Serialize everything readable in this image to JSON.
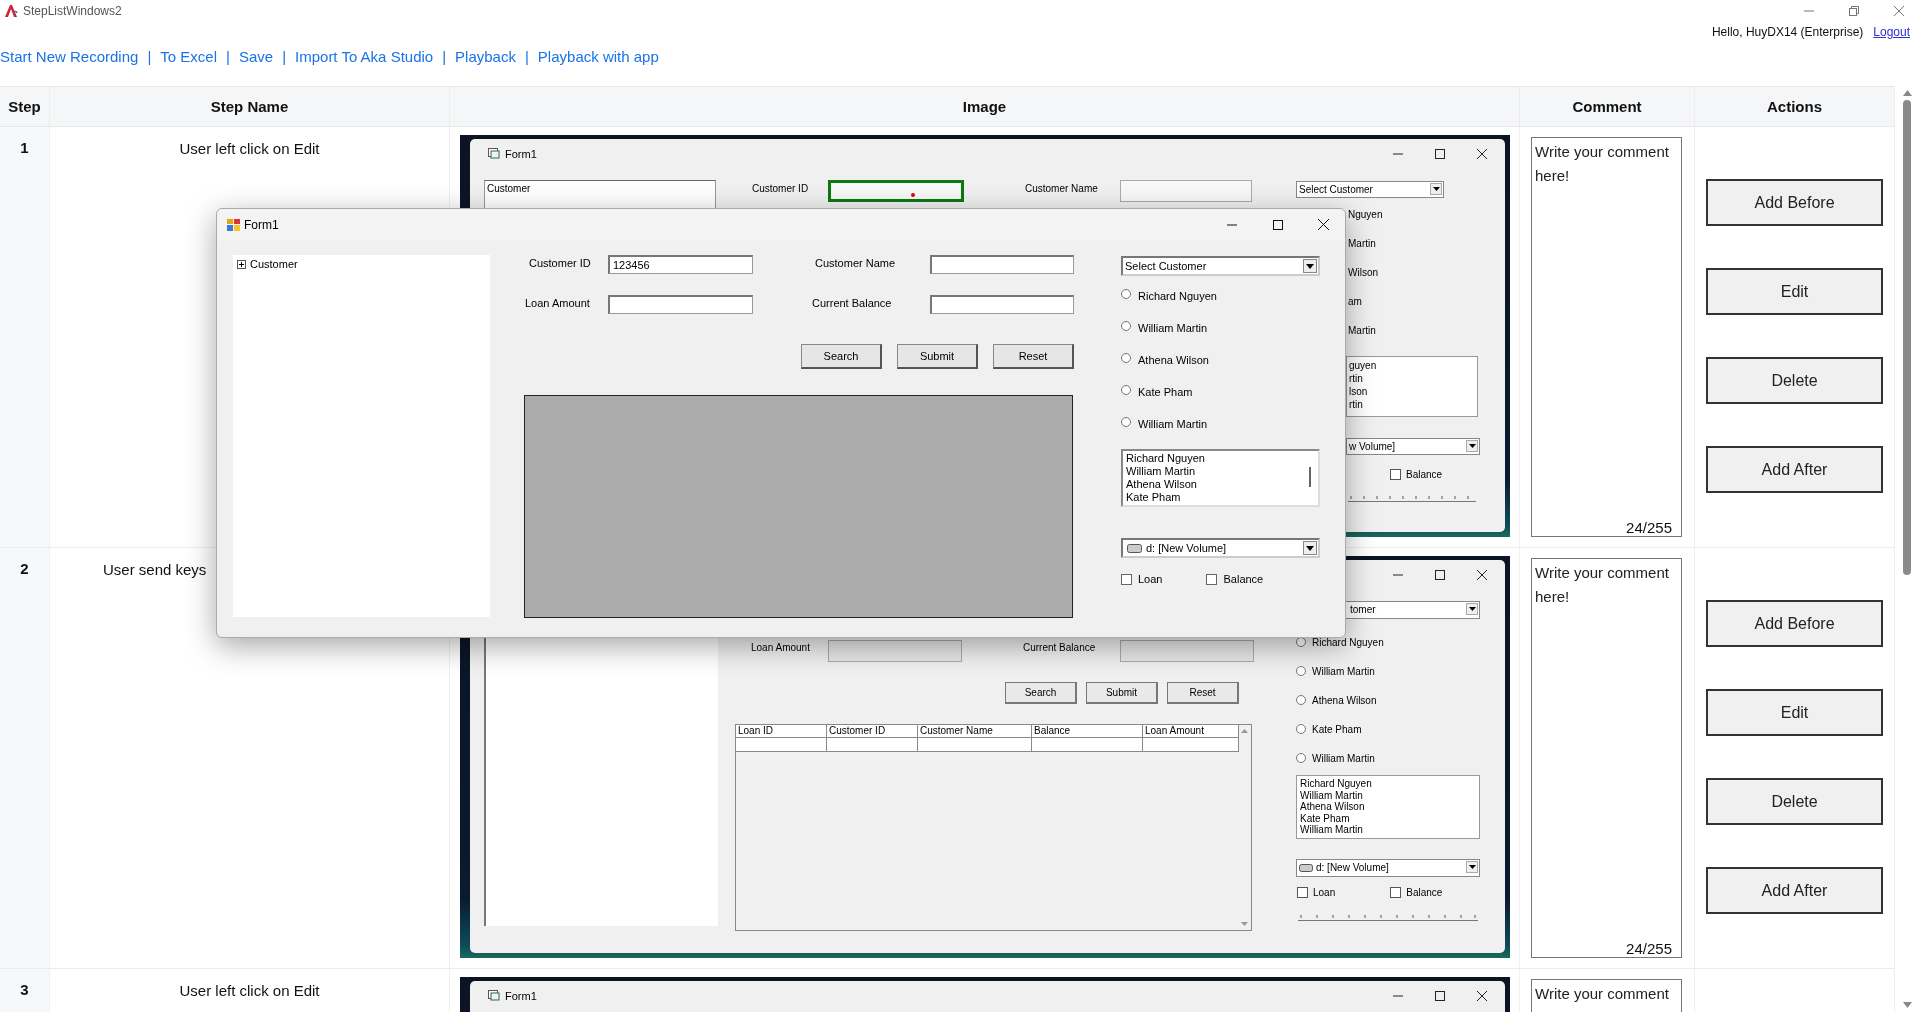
{
  "window": {
    "title": "StepListWindows2"
  },
  "account": {
    "greeting": "Hello, HuyDX14 (Enterprise)",
    "logout": "Logout"
  },
  "links": [
    {
      "label": "Start New Recording"
    },
    {
      "label": "To Excel"
    },
    {
      "label": "Save"
    },
    {
      "label": "Import To Aka Studio"
    },
    {
      "label": "Playback"
    },
    {
      "label": "Playback with app"
    }
  ],
  "separators": [
    "|",
    "|",
    "|",
    "|",
    "|"
  ],
  "table": {
    "columns": [
      "Step",
      "Step Name",
      "Image",
      "Comment",
      "Actions"
    ],
    "rows": [
      {
        "step": "1",
        "name": "User left click on Edit",
        "clipped": false,
        "comment": {
          "placeholder": "Write your comment here!",
          "count": "24/255"
        },
        "actions": [
          "Add Before",
          "Edit",
          "Delete",
          "Add After"
        ],
        "screenshot": {
          "kind": "top",
          "title": "Form1",
          "tree_field": "Customer",
          "fields": [
            {
              "label": "Customer ID",
              "highlighted": true
            },
            {
              "label": "Customer Name",
              "highlighted": false
            }
          ],
          "dropdown": "Select Customer",
          "radio_tails": [
            "Nguyen",
            "Martin",
            "Wilson",
            "am",
            "Martin"
          ],
          "list_tails": [
            "guyen",
            "rtin",
            "lson",
            "rtin"
          ],
          "drive_tail": "w Volume]",
          "checkboxes": [
            {
              "label": "Balance",
              "checked": false
            }
          ]
        }
      },
      {
        "step": "2",
        "name": "User send keys",
        "clipped": true,
        "comment": {
          "placeholder": "Write your comment here!",
          "count": "24/255"
        },
        "actions": [
          "Add Before",
          "Edit",
          "Delete",
          "Add After"
        ],
        "screenshot": {
          "kind": "bottom",
          "dropdown_tail": "tomer",
          "fields": [
            {
              "label": "Loan Amount"
            },
            {
              "label": "Current Balance"
            }
          ],
          "buttons": [
            "Search",
            "Submit",
            "Reset"
          ],
          "grid_columns": [
            "Loan ID",
            "Customer ID",
            "Customer Name",
            "Balance",
            "Loan Amount"
          ],
          "radios": [
            {
              "label": "Richard Nguyen",
              "selected": false
            },
            {
              "label": "William Martin",
              "selected": false
            },
            {
              "label": "Athena Wilson",
              "selected": false
            },
            {
              "label": "Kate Pham",
              "selected": false
            },
            {
              "label": "William Martin",
              "selected": false
            }
          ],
          "listbox": [
            "Richard Nguyen",
            "William Martin",
            "Athena Wilson",
            "Kate Pham",
            "William Martin"
          ],
          "drive": "d: [New Volume]",
          "checkboxes": [
            {
              "label": "Loan",
              "checked": false
            },
            {
              "label": "Balance",
              "checked": false
            }
          ]
        }
      },
      {
        "step": "3",
        "name": "User left click on Edit",
        "clipped": false,
        "comment": {
          "placeholder": "Write your comment"
        },
        "actions": [],
        "screenshot": {
          "kind": "title",
          "title": "Form1"
        }
      }
    ]
  },
  "dialog": {
    "title": "Form1",
    "tree": [
      {
        "label": "Customer",
        "expanded": false
      }
    ],
    "fields": [
      {
        "label": "Customer ID",
        "value": "123456"
      },
      {
        "label": "Customer Name"
      },
      {
        "label": "Loan Amount"
      },
      {
        "label": "Current Balance"
      }
    ],
    "buttons": [
      "Search",
      "Submit",
      "Reset"
    ],
    "dropdown": "Select Customer",
    "radios": [
      {
        "label": "Richard Nguyen",
        "selected": false
      },
      {
        "label": "William Martin",
        "selected": false
      },
      {
        "label": "Athena Wilson",
        "selected": false
      },
      {
        "label": "Kate Pham",
        "selected": false
      },
      {
        "label": "William Martin",
        "selected": false
      }
    ],
    "listbox": [
      "Richard Nguyen",
      "William Martin",
      "Athena Wilson",
      "Kate Pham"
    ],
    "drive": "d: [New Volume]",
    "checkboxes": [
      {
        "label": "Loan",
        "checked": false
      },
      {
        "label": "Balance",
        "checked": false
      }
    ]
  }
}
